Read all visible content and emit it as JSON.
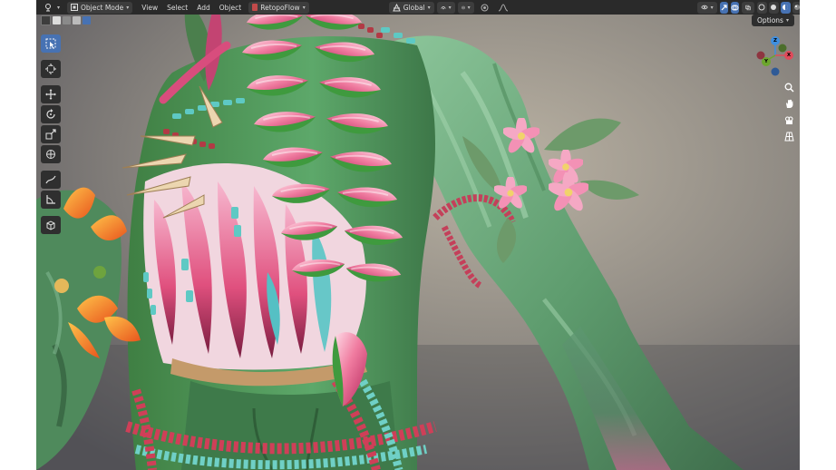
{
  "header": {
    "mode_label": "Object Mode",
    "menus": [
      "View",
      "Select",
      "Add",
      "Object"
    ],
    "addon_label": "RetopoFlow",
    "transform_orientation": "Global",
    "options_label": "Options"
  },
  "gizmo": {
    "x_label": "X",
    "y_label": "Y",
    "z_label": "Z"
  },
  "icons": [
    "editor-type-icon",
    "object-mode-icon",
    "retopoflow-icon",
    "orientation-icon",
    "pivot-icon",
    "snap-icon",
    "proportional-edit-icon",
    "falloff-icon",
    "visibility-icon",
    "gizmo-icon",
    "overlay-icon",
    "xray-icon",
    "shading-wireframe-icon",
    "shading-solid-icon",
    "shading-material-icon",
    "shading-rendered-icon",
    "select-box-icon",
    "cursor-icon",
    "move-icon",
    "rotate-icon",
    "scale-icon",
    "transform-icon",
    "annotate-icon",
    "measure-icon",
    "add-cube-icon",
    "zoom-icon",
    "pan-hand-icon",
    "camera-view-icon",
    "ortho-grid-icon"
  ],
  "colors": {
    "header_bg": "#2a2a2a",
    "button_bg": "#3d3d3d",
    "active_blue": "#4772b3",
    "axis_x": "#e04a5a",
    "axis_y": "#6ca62d",
    "axis_z": "#3f8fe0",
    "skin_green": "#6fae82",
    "flower_pink": "#e0507e"
  }
}
